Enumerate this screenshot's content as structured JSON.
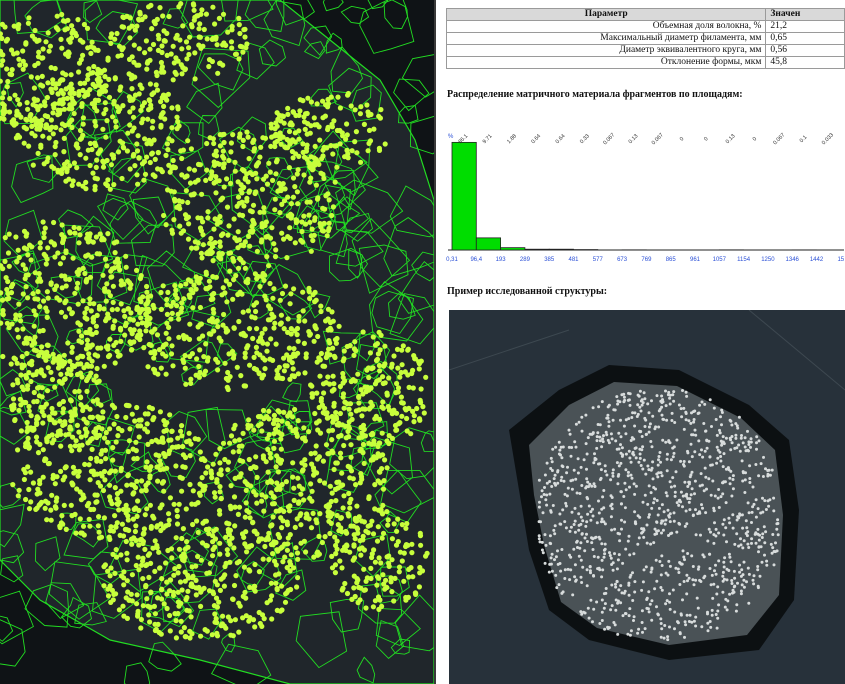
{
  "table": {
    "header": {
      "param": "Параметр",
      "value": "Значен"
    },
    "rows": [
      {
        "name": "Объемная доля волокна, %",
        "value": "21,2"
      },
      {
        "name": "Максимальный диаметр филамента, мм",
        "value": "0,65"
      },
      {
        "name": "Диаметр эквивалентного круга, мм",
        "value": "0,56"
      },
      {
        "name": "Отклонение формы, мкм",
        "value": "45,8"
      }
    ]
  },
  "distribution_title": "Распределение матричного материала фрагментов по площадям:",
  "example_title": "Пример исследованной структуры:",
  "chart_data": {
    "type": "bar",
    "title": "",
    "unit_label": "%",
    "value_labels": [
      "86.1",
      "9.71",
      "1.88",
      "0.64",
      "0.64",
      "0.33",
      "0.067",
      "0.13",
      "0.067",
      "0",
      "0",
      "0.13",
      "0",
      "0.067",
      "0.1",
      "0.033"
    ],
    "values": [
      86.1,
      9.71,
      1.88,
      0.64,
      0.64,
      0.33,
      0.067,
      0.13,
      0.067,
      0,
      0,
      0.13,
      0,
      0.067,
      0.1,
      0.033
    ],
    "x_ticks": [
      "0,31",
      "96,4",
      "193",
      "289",
      "385",
      "481",
      "577",
      "673",
      "769",
      "865",
      "961",
      "1057",
      "1154",
      "1250",
      "1346",
      "1442",
      "15"
    ],
    "bar_color": "#00dd00",
    "ylim": [
      0,
      100
    ]
  },
  "colors": {
    "micro_bg": "#101418",
    "fiber_fill": "#c8ff3c",
    "cell_line": "#22dd22",
    "sample_bg": "#27313a",
    "label_blue": "#2a4fd6"
  }
}
